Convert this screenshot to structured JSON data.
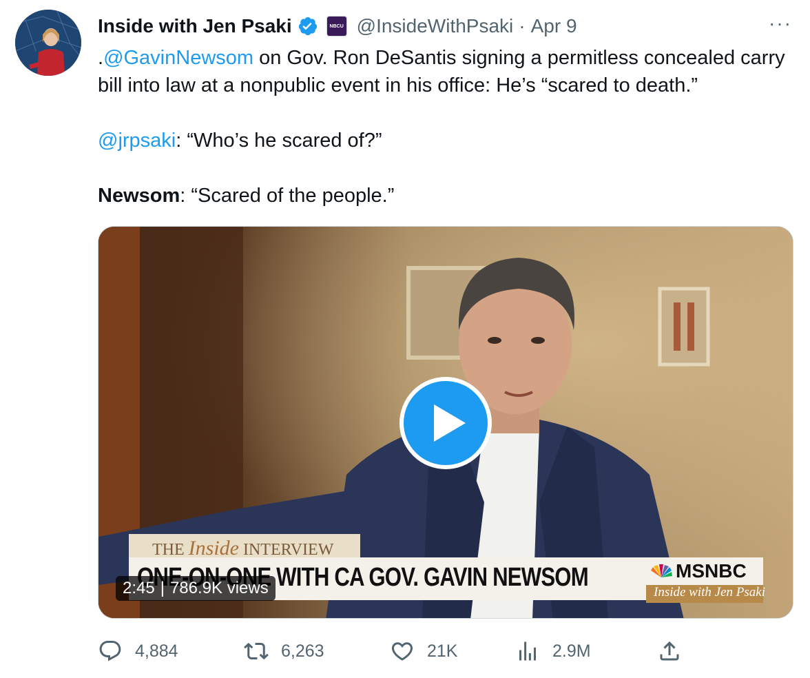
{
  "author": {
    "name": "Inside with Jen Psaki",
    "org_badge": "NBCU",
    "handle": "@InsideWithPsaki",
    "separator": "·",
    "date": "Apr 9"
  },
  "more_label": "···",
  "tweet": {
    "line1_prefix": ".",
    "line1_mention": "@GavinNewsom",
    "line1_rest": " on Gov. Ron DeSantis signing a permitless concealed carry bill into law at a nonpublic event in his office: He’s “scared to death.”",
    "line2_mention": "@jrpsaki",
    "line2_rest": ": “Who’s he scared of?”",
    "line3_bold": "Newsom",
    "line3_rest": ": “Scared of the people.”"
  },
  "video": {
    "lower_third_top_1": "THE ",
    "lower_third_top_2": "Inside",
    "lower_third_top_3": " INTERVIEW",
    "lower_third_headline": "ONE-ON-ONE WITH CA GOV. GAVIN NEWSOM",
    "network": "MSNBC",
    "show": "Inside with Jen Psaki",
    "duration": "2:45",
    "views": "786.9K views"
  },
  "actions": {
    "replies": "4,884",
    "retweets": "6,263",
    "likes": "21K",
    "views": "2.9M"
  },
  "colors": {
    "accent": "#1d9bf0",
    "muted": "#536471",
    "text": "#0f1419"
  },
  "icons": [
    "verified-badge-icon",
    "more-icon",
    "play-icon",
    "reply-icon",
    "retweet-icon",
    "like-icon",
    "views-icon",
    "share-icon"
  ]
}
